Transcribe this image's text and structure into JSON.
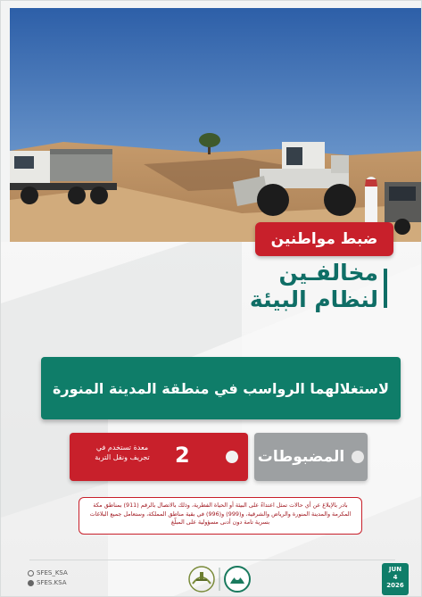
{
  "banner": {
    "title": "ضبط مواطنين"
  },
  "headline": {
    "line1": "مخالفـين",
    "line2": "لنظام البيئة"
  },
  "violation": {
    "text": "لاستغلالهما الرواسب في منطقة المدينة المنورة"
  },
  "seized": {
    "label": "المضبوطات",
    "count": "2",
    "description": "معدة تستخدم في تجريف ونقل التربة"
  },
  "notice": {
    "text": "بادر بالإبلاغ عن أي حالات تمثل اعتداءً على البيئة أو الحياة الفطرية، وذلك بالاتصال بالرقم (911) بمناطق مكة المكرمة والمدينة المنورة والرياض والشرقية، و(999) و(996) في بقية مناطق المملكة، وستعامل جميع البلاغات بسرية تامة دون أدنى مسؤولية على المبلّغ"
  },
  "social": {
    "x_handle": "SFES_KSA",
    "snap_handle": "SFES.KSA"
  },
  "date": {
    "month": "JUN",
    "day": "4",
    "year": "2026"
  },
  "colors": {
    "red": "#c8202b",
    "green": "#0f7d69",
    "gray": "#9da0a2",
    "title_green": "#0f6e66"
  }
}
